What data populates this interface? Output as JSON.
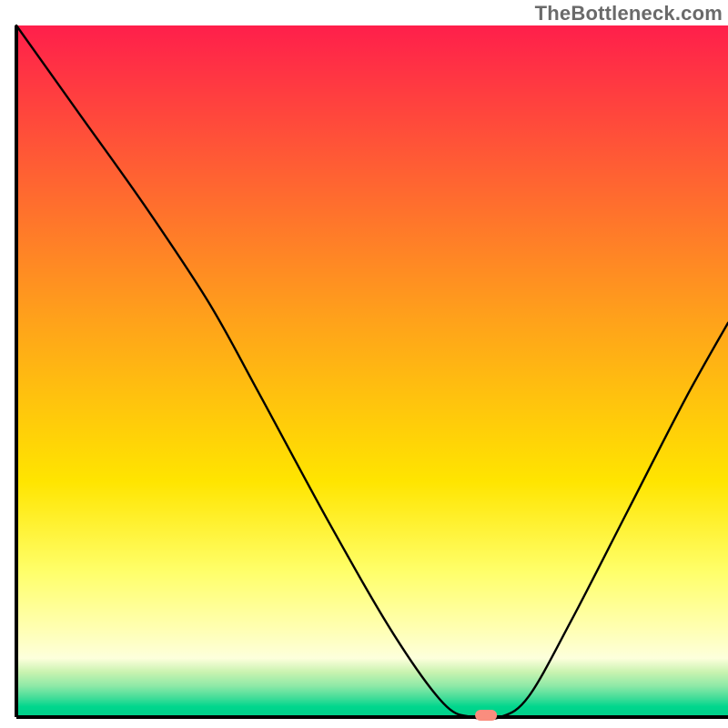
{
  "watermark": "TheBottleneck.com",
  "chart_data": {
    "type": "line",
    "title": "",
    "xlabel": "",
    "ylabel": "",
    "xlim": [
      0,
      100
    ],
    "ylim": [
      0,
      100
    ],
    "x": [
      0,
      9,
      18,
      27,
      34,
      44,
      53,
      60,
      64,
      68,
      72,
      78,
      86,
      94,
      100
    ],
    "values": [
      100,
      87,
      74,
      60,
      47,
      28,
      12,
      2,
      0,
      0,
      3,
      14,
      30,
      46,
      57
    ],
    "marker": {
      "x": 66,
      "y": 0,
      "color": "#fa8d7e"
    },
    "gradient_stops": [
      {
        "offset": 0.0,
        "color": "#ff1f4b"
      },
      {
        "offset": 0.43,
        "color": "#ffa31a"
      },
      {
        "offset": 0.66,
        "color": "#ffe500"
      },
      {
        "offset": 0.79,
        "color": "#ffff6a"
      },
      {
        "offset": 0.87,
        "color": "#ffffb0"
      },
      {
        "offset": 0.915,
        "color": "#fdffdc"
      },
      {
        "offset": 0.935,
        "color": "#c9f3b0"
      },
      {
        "offset": 0.955,
        "color": "#8ee9a7"
      },
      {
        "offset": 0.972,
        "color": "#43dd99"
      },
      {
        "offset": 0.985,
        "color": "#00d68d"
      },
      {
        "offset": 1.0,
        "color": "#00d08a"
      }
    ]
  }
}
